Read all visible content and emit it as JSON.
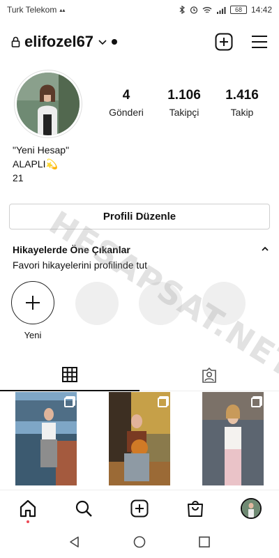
{
  "status_bar": {
    "carrier": "Turk Telekom",
    "battery": "68",
    "time": "14:42"
  },
  "header": {
    "username": "elifozel67"
  },
  "profile": {
    "stats": [
      {
        "value": "4",
        "label": "Gönderi"
      },
      {
        "value": "1.106",
        "label": "Takipçi"
      },
      {
        "value": "1.416",
        "label": "Takip"
      }
    ],
    "bio": {
      "line1": "\"Yeni Hesap\"",
      "line2": "ALAPLI💫",
      "line3": "21"
    },
    "edit_button": "Profili Düzenle"
  },
  "highlights": {
    "title": "Hikayelerde Öne Çıkanlar",
    "subtitle": "Favori hikayelerini profilinde tut",
    "new_label": "Yeni"
  },
  "watermark": "HESAPSAT.NET",
  "colors": {
    "accent_red": "#ed4956",
    "divider": "#efefef"
  }
}
